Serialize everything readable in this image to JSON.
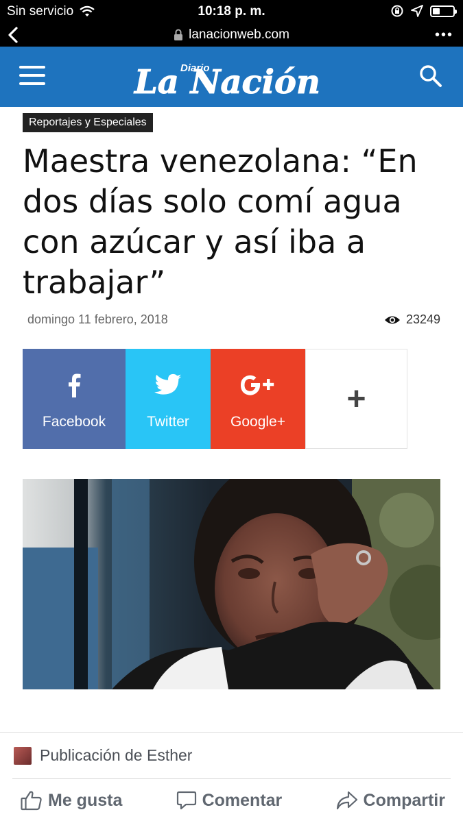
{
  "status_bar": {
    "carrier": "Sin servicio",
    "time": "10:18 p. m.",
    "icons": [
      "wifi-icon",
      "rotation-lock-icon",
      "location-icon",
      "battery-icon"
    ],
    "battery_level": 0.3
  },
  "browser": {
    "url": "lanacionweb.com",
    "back_icon": "chevron-left-icon",
    "lock_icon": "lock-icon",
    "more_icon": "ellipsis-icon"
  },
  "site_header": {
    "logo_small": "Diario",
    "logo_main": "La Nación",
    "accent_color": "#1e73be",
    "menu_icon": "hamburger-icon",
    "search_icon": "search-icon"
  },
  "article": {
    "category": "Reportajes y Especiales",
    "title": "Maestra venezolana: “En dos días solo comí agua con azúcar y así iba a trabajar”",
    "date": "domingo 11 febrero, 2018",
    "views": "23249",
    "views_icon": "eye-icon"
  },
  "share": {
    "facebook": {
      "label": "Facebook",
      "color": "#516eab",
      "icon": "facebook-icon"
    },
    "twitter": {
      "label": "Twitter",
      "color": "#29c5f6",
      "icon": "twitter-icon"
    },
    "google": {
      "label": "Google+",
      "color": "#eb4026",
      "icon": "google-plus-icon"
    },
    "more": {
      "label": "+",
      "icon": "plus-icon"
    }
  },
  "facebook_footer": {
    "publication": "Publicación de Esther",
    "like": "Me gusta",
    "comment": "Comentar",
    "share": "Compartir"
  }
}
